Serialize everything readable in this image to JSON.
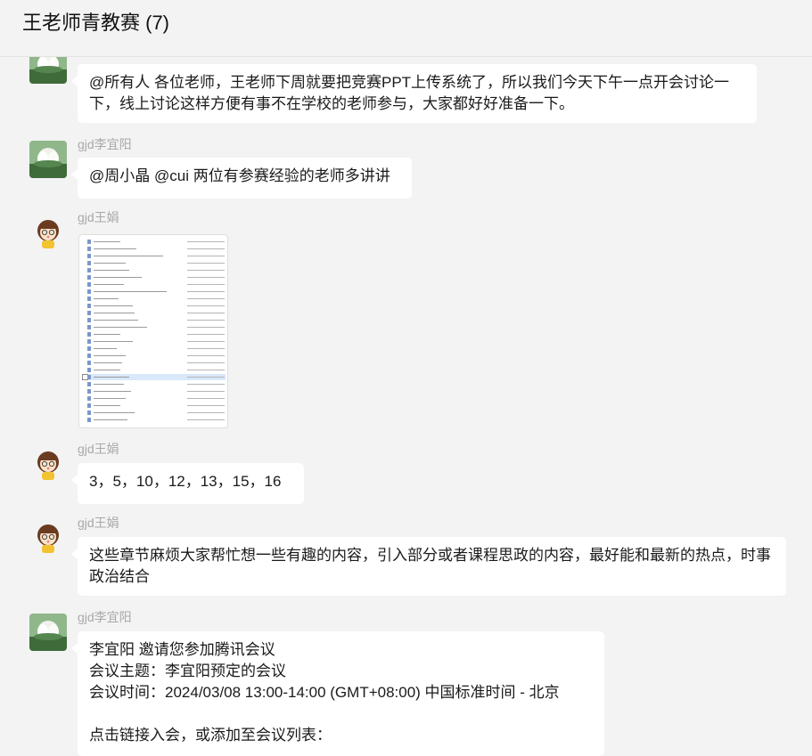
{
  "chat": {
    "title": "王老师青教赛 (7)"
  },
  "messages": [
    {
      "sender": "",
      "avatar": "lotus-avatar-icon",
      "text": "@所有人 各位老师，王老师下周就要把竞赛PPT上传系统了，所以我们今天下午一点开会讨论一下，线上讨论这样方便有事不在学校的老师参与，大家都好好准备一下。"
    },
    {
      "sender": "gjd李宜阳",
      "avatar": "lotus-avatar-icon",
      "text": "@周小晶 @cui 两位有参赛经验的老师多讲讲"
    },
    {
      "sender": "gjd王娟",
      "avatar": "cartoon-girl-avatar-icon",
      "image": "file-list-screenshot"
    },
    {
      "sender": "gjd王娟",
      "avatar": "cartoon-girl-avatar-icon",
      "text": "3，5，10，12，13，15，16"
    },
    {
      "sender": "gjd王娟",
      "avatar": "cartoon-girl-avatar-icon",
      "text": "这些章节麻烦大家帮忙想一些有趣的内容，引入部分或者课程思政的内容，最好能和最新的热点，时事政治结合"
    },
    {
      "sender": "gjd李宜阳",
      "avatar": "lotus-avatar-icon",
      "lines": [
        "李宜阳 邀请您参加腾讯会议",
        "会议主题：李宜阳预定的会议",
        "会议时间：2024/03/08 13:00-14:00 (GMT+08:00) 中国标准时间 - 北京",
        "",
        "点击链接入会，或添加至会议列表："
      ]
    }
  ],
  "colors": {
    "background": "#f3f3f3",
    "bubble": "#ffffff",
    "sender_name": "#a9a9a9",
    "selected_row": "#d9e8fb"
  }
}
